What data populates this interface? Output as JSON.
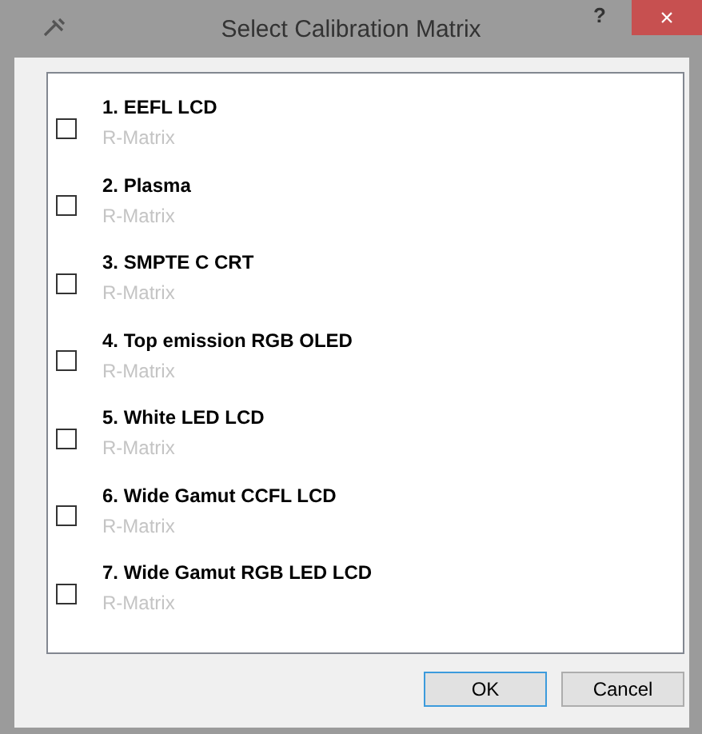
{
  "window": {
    "title": "Select Calibration Matrix",
    "help": "?",
    "close": "×"
  },
  "items": [
    {
      "label": "1. EEFL LCD",
      "sub": "R-Matrix",
      "checked": false
    },
    {
      "label": "2. Plasma",
      "sub": "R-Matrix",
      "checked": false
    },
    {
      "label": "3. SMPTE C CRT",
      "sub": "R-Matrix",
      "checked": false
    },
    {
      "label": "4. Top emission RGB OLED",
      "sub": "R-Matrix",
      "checked": false
    },
    {
      "label": "5. White LED LCD",
      "sub": "R-Matrix",
      "checked": false
    },
    {
      "label": "6. Wide Gamut CCFL LCD",
      "sub": "R-Matrix",
      "checked": false
    },
    {
      "label": "7. Wide Gamut RGB LED LCD",
      "sub": "R-Matrix",
      "checked": false
    }
  ],
  "buttons": [
    {
      "label": "OK",
      "selected": true
    },
    {
      "label": "Cancel",
      "selected": false
    }
  ]
}
